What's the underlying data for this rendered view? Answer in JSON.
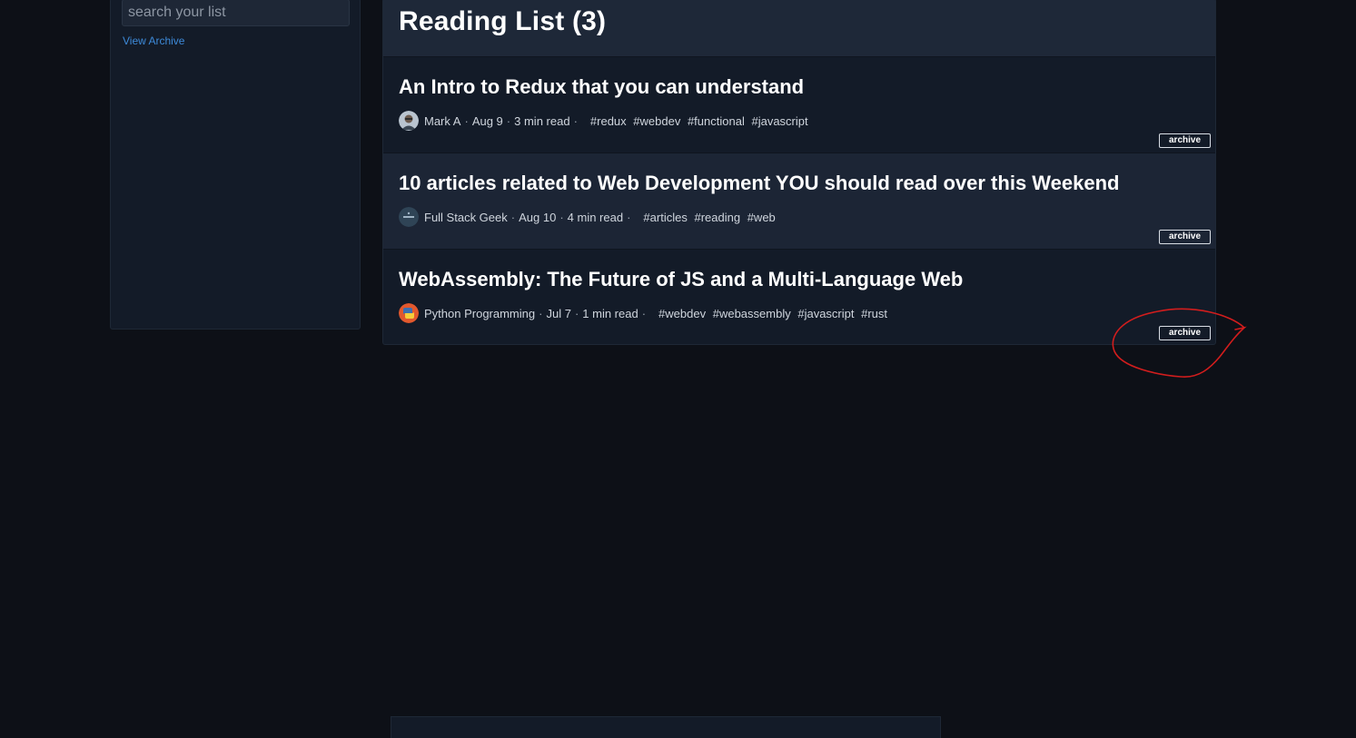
{
  "sidebar": {
    "search_placeholder": "search your list",
    "view_archive_label": "View Archive"
  },
  "reading_list": {
    "title": "Reading List (3)",
    "archive_label": "archive",
    "items": [
      {
        "title": "An Intro to Redux that you can understand",
        "author": "Mark A",
        "date": "Aug 9",
        "read_time": "3 min read",
        "tags": [
          "#redux",
          "#webdev",
          "#functional",
          "#javascript"
        ],
        "avatar_icon": "user-photo-avatar"
      },
      {
        "title": "10 articles related to Web Development YOU should read over this Weekend",
        "author": "Full Stack Geek",
        "date": "Aug 10",
        "read_time": "4 min read",
        "tags": [
          "#articles",
          "#reading",
          "#web"
        ],
        "avatar_icon": "logo-avatar"
      },
      {
        "title": "WebAssembly: The Future of JS and a Multi-Language Web",
        "author": "Python Programming",
        "date": "Jul 7",
        "read_time": "1 min read",
        "tags": [
          "#webdev",
          "#webassembly",
          "#javascript",
          "#rust"
        ],
        "avatar_icon": "python-logo-avatar"
      }
    ]
  },
  "colors": {
    "background": "#0d1017",
    "panel": "#131b28",
    "panel_alt": "#1c2535",
    "link": "#3d8ad9",
    "annotation": "#d21d1d"
  }
}
